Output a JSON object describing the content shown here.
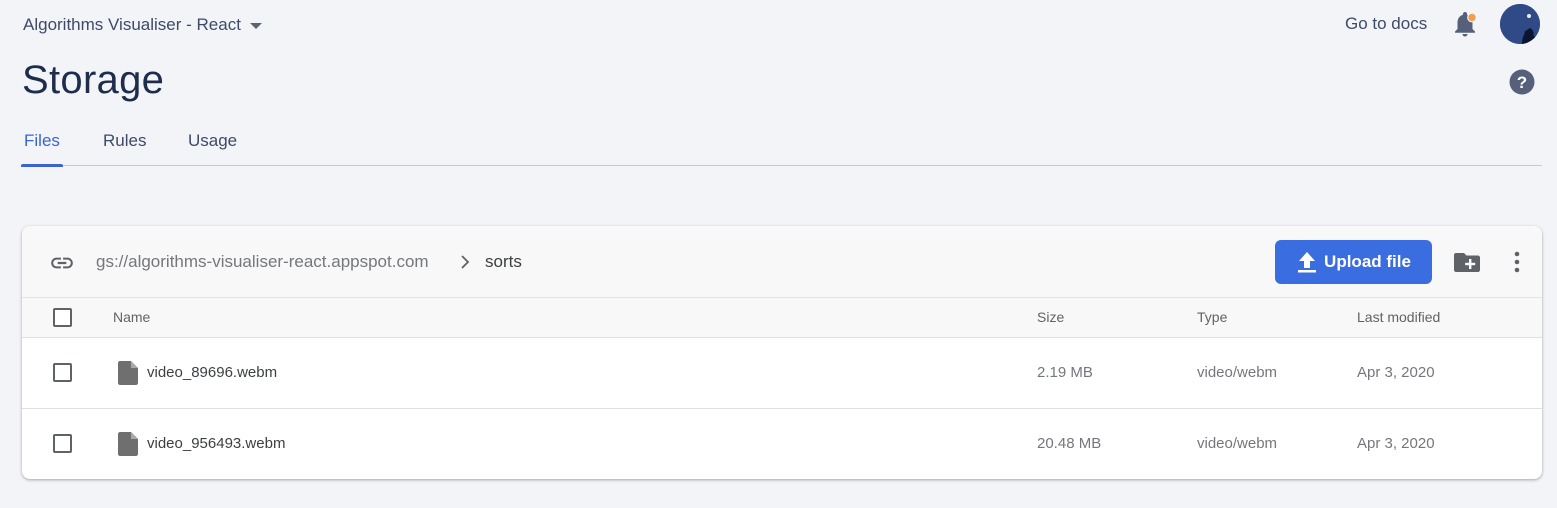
{
  "header": {
    "project_name": "Algorithms Visualiser - React",
    "docs_link": "Go to docs",
    "notification_dot_color": "#f29d50"
  },
  "page": {
    "title": "Storage"
  },
  "tabs": [
    {
      "label": "Files",
      "active": true
    },
    {
      "label": "Rules",
      "active": false
    },
    {
      "label": "Usage",
      "active": false
    }
  ],
  "browser": {
    "bucket": "gs://algorithms-visualiser-react.appspot.com",
    "folder": "sorts",
    "upload_label": "Upload file",
    "columns": {
      "name": "Name",
      "size": "Size",
      "type": "Type",
      "modified": "Last modified"
    },
    "files": [
      {
        "name": "video_89696.webm",
        "size": "2.19 MB",
        "type": "video/webm",
        "modified": "Apr 3, 2020"
      },
      {
        "name": "video_956493.webm",
        "size": "20.48 MB",
        "type": "video/webm",
        "modified": "Apr 3, 2020"
      }
    ]
  },
  "colors": {
    "accent": "#3a64cf",
    "upload_button": "#3a6ddf",
    "background": "#f3f4f8"
  }
}
